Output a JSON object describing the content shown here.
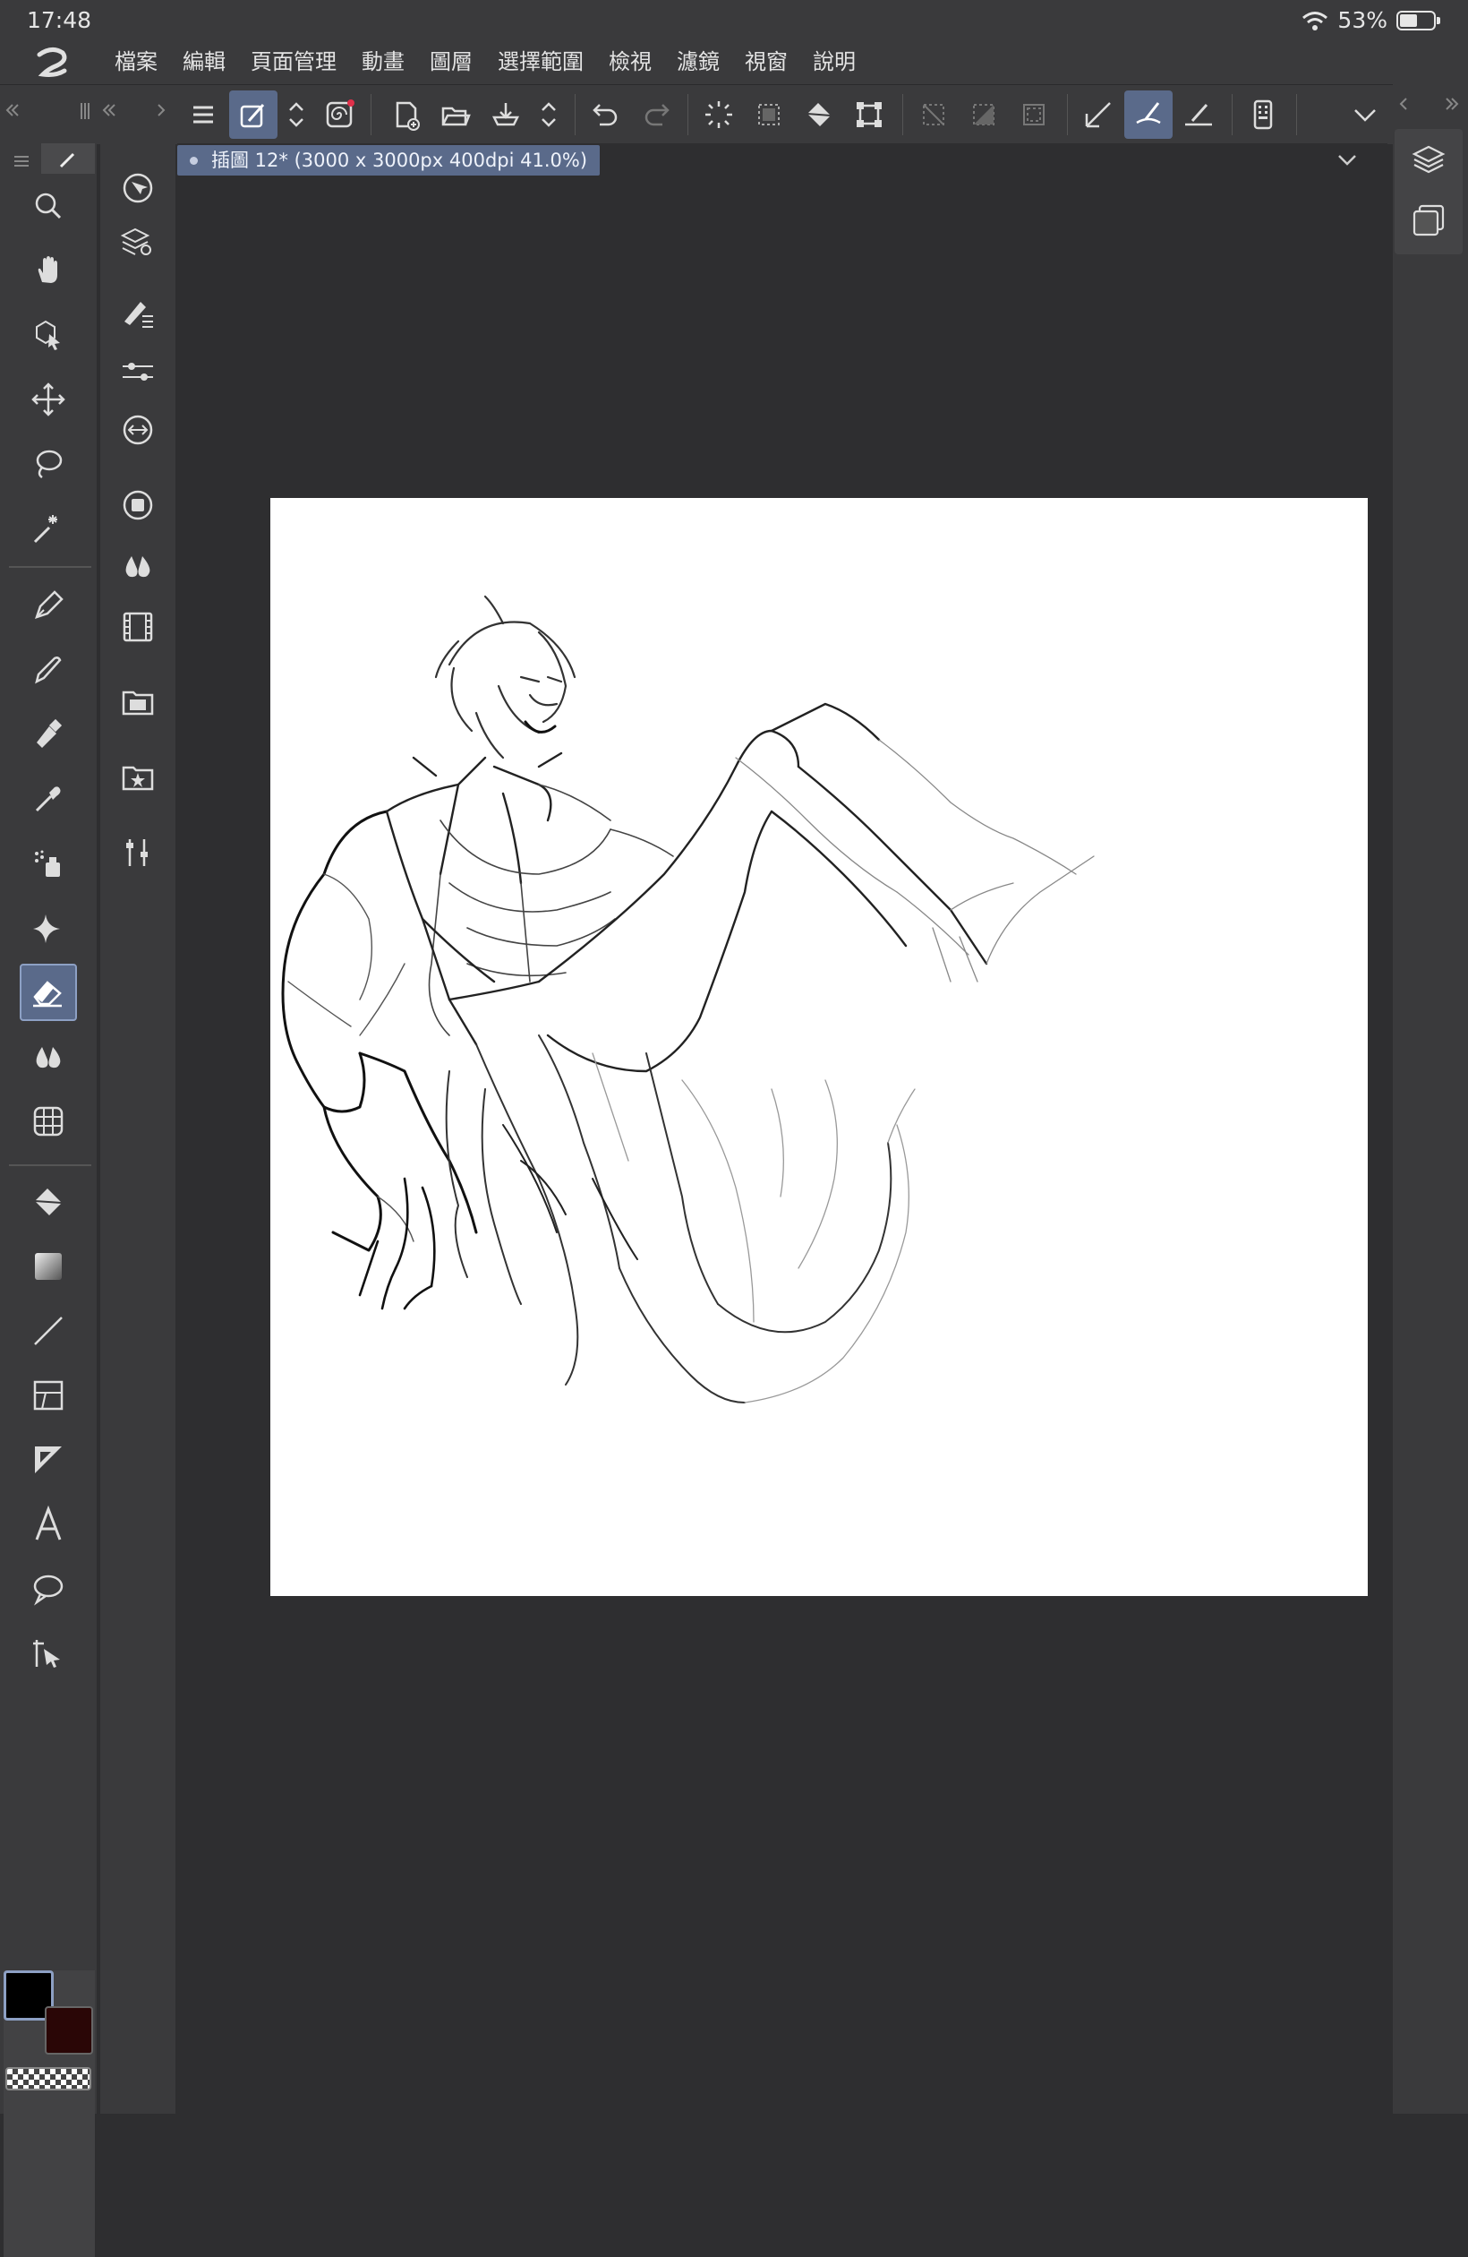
{
  "status": {
    "time": "17:48",
    "battery_label": "53%",
    "battery_level": 0.53
  },
  "menu": {
    "items": [
      "檔案",
      "編輯",
      "頁面管理",
      "動畫",
      "圖層",
      "選擇範圍",
      "檢視",
      "濾鏡",
      "視窗",
      "說明"
    ]
  },
  "document": {
    "tab_label": "插圖 12* (3000 x 3000px 400dpi 41.0%)"
  },
  "colors": {
    "main": "#000000",
    "sub": "#2a0606",
    "accent": "#5a6a8a",
    "ui_bg": "#3a3a3c",
    "canvas_bg": "#2e2e30"
  }
}
